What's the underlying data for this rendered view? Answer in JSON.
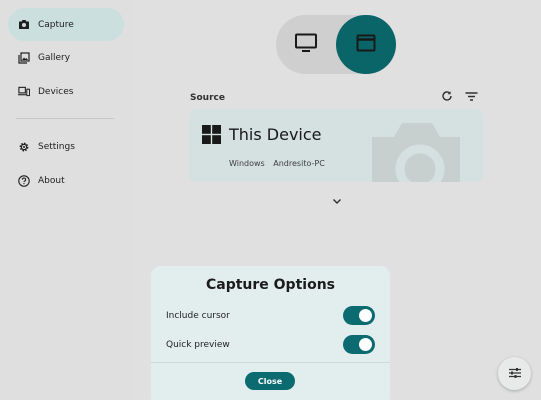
{
  "sidebar": {
    "items": [
      {
        "label": "Capture",
        "icon": "camera-icon",
        "active": true
      },
      {
        "label": "Gallery",
        "icon": "gallery-icon",
        "active": false
      },
      {
        "label": "Devices",
        "icon": "devices-icon",
        "active": false
      },
      {
        "label": "Settings",
        "icon": "gear-icon",
        "active": false
      },
      {
        "label": "About",
        "icon": "help-icon",
        "active": false
      }
    ]
  },
  "mode_selector": {
    "options": [
      {
        "icon": "monitor-icon",
        "selected": false
      },
      {
        "icon": "window-icon",
        "selected": true
      }
    ]
  },
  "source": {
    "title": "Source",
    "actions": [
      {
        "icon": "refresh-icon"
      },
      {
        "icon": "filter-icon"
      }
    ],
    "device": {
      "name": "This Device",
      "os": "Windows",
      "hostname": "Andresito-PC",
      "logo": "windows-logo-icon"
    }
  },
  "dialog": {
    "title": "Capture Options",
    "options": [
      {
        "label": "Include cursor",
        "enabled": true
      },
      {
        "label": "Quick preview",
        "enabled": true
      }
    ],
    "close_label": "Close"
  },
  "fab": {
    "icon": "tune-icon"
  },
  "colors": {
    "accent": "#0b6b70",
    "nav_active": "#d8ecec",
    "card_bg": "#e2eded",
    "dialog_bg": "#e2eeee"
  }
}
